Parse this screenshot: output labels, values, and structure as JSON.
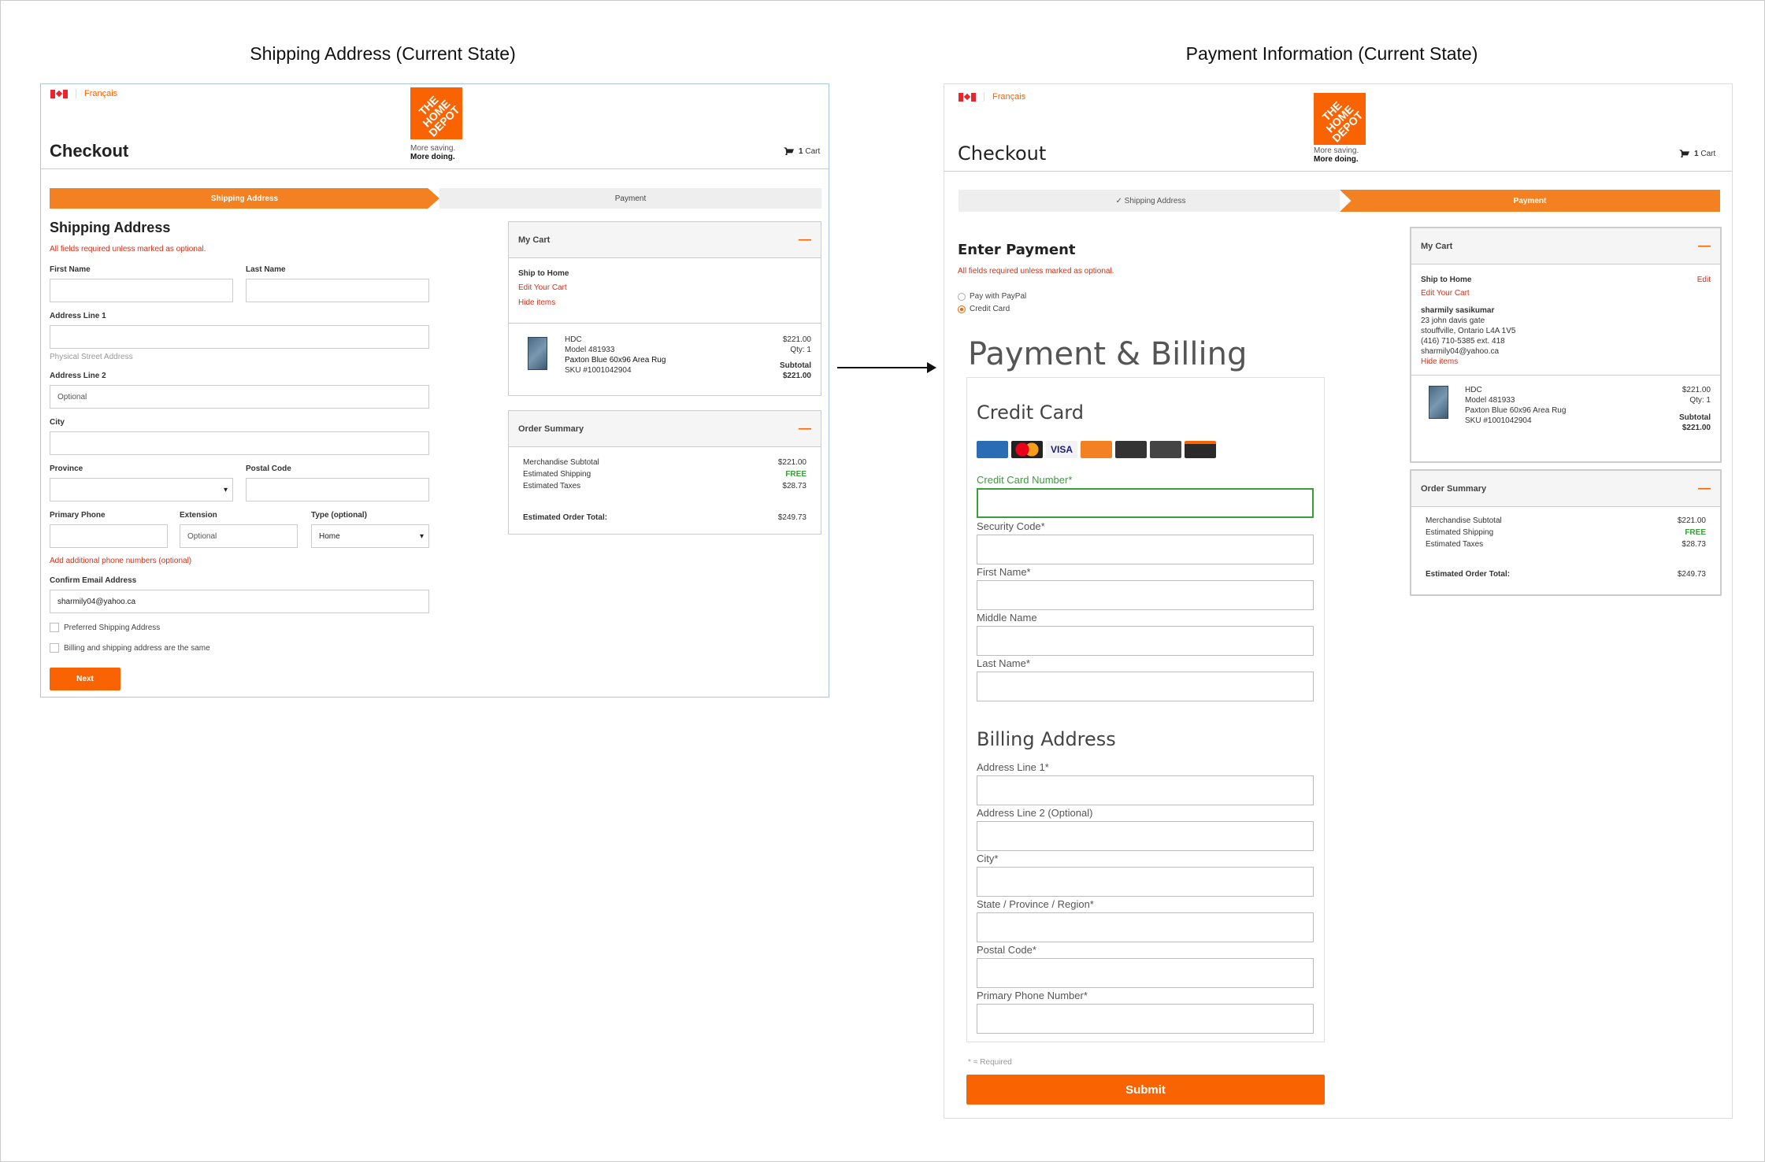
{
  "captions": {
    "left": "Shipping Address (Current State)",
    "right": "Payment Information (Current State)"
  },
  "brand": {
    "lang": "Français",
    "logo_text": "THE HOME DEPOT",
    "slogan_1": "More saving.",
    "slogan_2": "More doing.",
    "accent": "#f96302"
  },
  "header": {
    "title": "Checkout",
    "cart_count": "1",
    "cart_label": "Cart"
  },
  "left": {
    "steps": [
      "Shipping Address",
      "Payment"
    ],
    "heading": "Shipping Address",
    "required_note": "All fields required unless marked as optional.",
    "fields": {
      "first_name": "First Name",
      "last_name": "Last Name",
      "address1": "Address Line 1",
      "address1_hint": "Physical Street Address",
      "address2": "Address Line 2",
      "address2_placeholder": "Optional",
      "city": "City",
      "province": "Province",
      "postal": "Postal Code",
      "phone": "Primary Phone",
      "extension": "Extension",
      "extension_placeholder": "Optional",
      "type": "Type (optional)",
      "type_value": "Home",
      "add_phone_link": "Add additional phone numbers (optional)",
      "email_label": "Confirm Email Address",
      "email_value": "sharmily04@yahoo.ca"
    },
    "checkboxes": [
      "Preferred Shipping Address",
      "Billing and shipping address are the same"
    ],
    "next_button": "Next",
    "my_cart": {
      "title": "My Cart",
      "toggle": "—",
      "ship_to": "Ship to Home",
      "edit_cart": "Edit Your Cart",
      "hide_items": "Hide items",
      "item": {
        "brand": "HDC",
        "model": "Model 481933",
        "name": "Paxton Blue 60x96 Area Rug",
        "sku": "SKU #1001042904",
        "price": "$221.00",
        "qty": "Qty: 1",
        "subtotal_label": "Subtotal",
        "subtotal": "$221.00"
      }
    },
    "order_summary": {
      "title": "Order Summary",
      "toggle": "—",
      "rows": [
        {
          "label": "Merchandise Subtotal",
          "value": "$221.00"
        },
        {
          "label": "Estimated Shipping",
          "value": "FREE"
        },
        {
          "label": "Estimated Taxes",
          "value": "$28.73"
        }
      ],
      "total_label": "Estimated Order Total:",
      "total": "$249.73"
    }
  },
  "right": {
    "steps": [
      "✓  Shipping Address",
      "Payment"
    ],
    "heading": "Enter Payment",
    "required_note": "All fields required unless marked as optional.",
    "pay_options": [
      "Pay with PayPal",
      "Credit Card"
    ],
    "billing_title": "Payment & Billing",
    "credit_card_title": "Credit Card",
    "card_fields": [
      "Credit Card Number*",
      "Security Code*",
      "First Name*",
      "Middle Name",
      "Last Name*"
    ],
    "billing_address_title": "Billing Address",
    "address_fields": [
      "Address Line 1*",
      "Address Line 2 (Optional)",
      "City*",
      "State / Province / Region*",
      "Postal Code*",
      "Primary Phone Number*"
    ],
    "required_legend": "* = Required",
    "submit_button": "Submit",
    "my_cart": {
      "title": "My Cart",
      "toggle": "—",
      "ship_to": "Ship to Home",
      "edit": "Edit",
      "edit_cart": "Edit Your Cart",
      "address": [
        "sharmily sasikumar",
        "23 john davis gate",
        "stouffville, Ontario L4A 1V5",
        "(416) 710-5385 ext. 418",
        "sharmily04@yahoo.ca"
      ],
      "hide_items": "Hide items",
      "item": {
        "brand": "HDC",
        "model": "Model 481933",
        "name": "Paxton Blue 60x96 Area Rug",
        "sku": "SKU #1001042904",
        "price": "$221.00",
        "qty": "Qty: 1",
        "subtotal_label": "Subtotal",
        "subtotal": "$221.00"
      }
    },
    "order_summary": {
      "title": "Order Summary",
      "toggle": "—",
      "rows": [
        {
          "label": "Merchandise Subtotal",
          "value": "$221.00"
        },
        {
          "label": "Estimated Shipping",
          "value": "FREE"
        },
        {
          "label": "Estimated Taxes",
          "value": "$28.73"
        }
      ],
      "total_label": "Estimated Order Total:",
      "total": "$249.73"
    }
  }
}
